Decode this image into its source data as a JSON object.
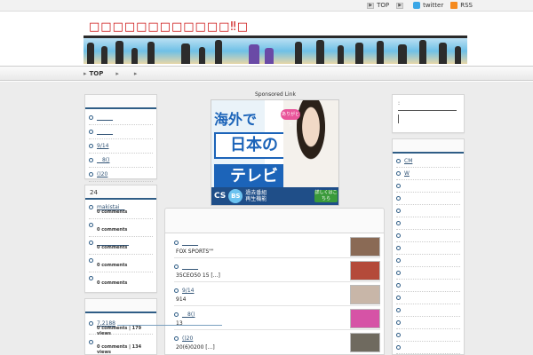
{
  "topbar": {
    "links": [
      {
        "label": "TOP",
        "icon": "arrow-icon"
      },
      {
        "label": "",
        "icon": "arrow-icon"
      },
      {
        "label": "twitter",
        "icon": "twitter-icon"
      },
      {
        "label": "RSS",
        "icon": "rss-icon"
      }
    ]
  },
  "site": {
    "title": "□□□□□□□□□□□□‼□",
    "title_color": "#cc1111"
  },
  "nav": {
    "items": [
      {
        "label": "TOP"
      },
      {
        "label": ""
      },
      {
        "label": ""
      }
    ]
  },
  "left_sidebar": {
    "box1": {
      "header": "",
      "items": [
        {
          "label": "______"
        },
        {
          "label": "______"
        },
        {
          "label": "9/14"
        },
        {
          "label": "__8()"
        },
        {
          "label": "()20"
        }
      ]
    },
    "box2": {
      "header": "24",
      "items": [
        {
          "label": "makistai__",
          "meta": "0 comments"
        },
        {
          "label": "",
          "meta": "0 comments"
        },
        {
          "label": "____________",
          "meta": "0 comments"
        },
        {
          "label": "",
          "meta": "0 comments"
        },
        {
          "label": "",
          "meta": "0 comments"
        }
      ]
    },
    "box3": {
      "header": "",
      "items": [
        {
          "label": "7,2188",
          "meta": "0 comments | 179 views"
        },
        {
          "label": "",
          "meta": "0 comments | 134 views"
        }
      ]
    }
  },
  "center": {
    "sponsored_label": "Sponsored Link",
    "ad": {
      "line1": "海外で",
      "line2": "日本の",
      "line3": "テレビ",
      "bubble": "ありがとう",
      "cs": "CS",
      "bs": "BS",
      "bottom_text1": "過去番組",
      "bottom_text2": "再生機能",
      "button": "詳しくはこちら"
    },
    "posts": [
      {
        "title": "______",
        "excerpt": "FOX SPORTS\"\"",
        "thumb_color": "#8a6a55"
      },
      {
        "title": "______",
        "excerpt": "35CEO50 15 [...]",
        "thumb_color": "#b44a3a"
      },
      {
        "title": "9/14",
        "excerpt": "914",
        "thumb_color": "#c8b6a8"
      },
      {
        "title": "__8()",
        "excerpt": "13",
        "thumb_color": "#d653a6"
      },
      {
        "title": "()20",
        "excerpt": "20(6)0200 [...]",
        "thumb_color": "#6f6a5f"
      }
    ]
  },
  "right_sidebar": {
    "box1": {
      "header": ":",
      "line": ""
    },
    "box2": {
      "header": "",
      "items": [
        {
          "label": "CM"
        },
        {
          "label": "W"
        },
        {
          "label": ""
        },
        {
          "label": ""
        },
        {
          "label": ""
        },
        {
          "label": ""
        },
        {
          "label": ""
        },
        {
          "label": ""
        },
        {
          "label": ""
        },
        {
          "label": ""
        },
        {
          "label": ""
        },
        {
          "label": ""
        },
        {
          "label": ""
        },
        {
          "label": ""
        },
        {
          "label": ""
        },
        {
          "label": ""
        }
      ]
    }
  },
  "colors": {
    "accent": "#2f5d86",
    "link": "#335577",
    "bg": "#ececec"
  }
}
